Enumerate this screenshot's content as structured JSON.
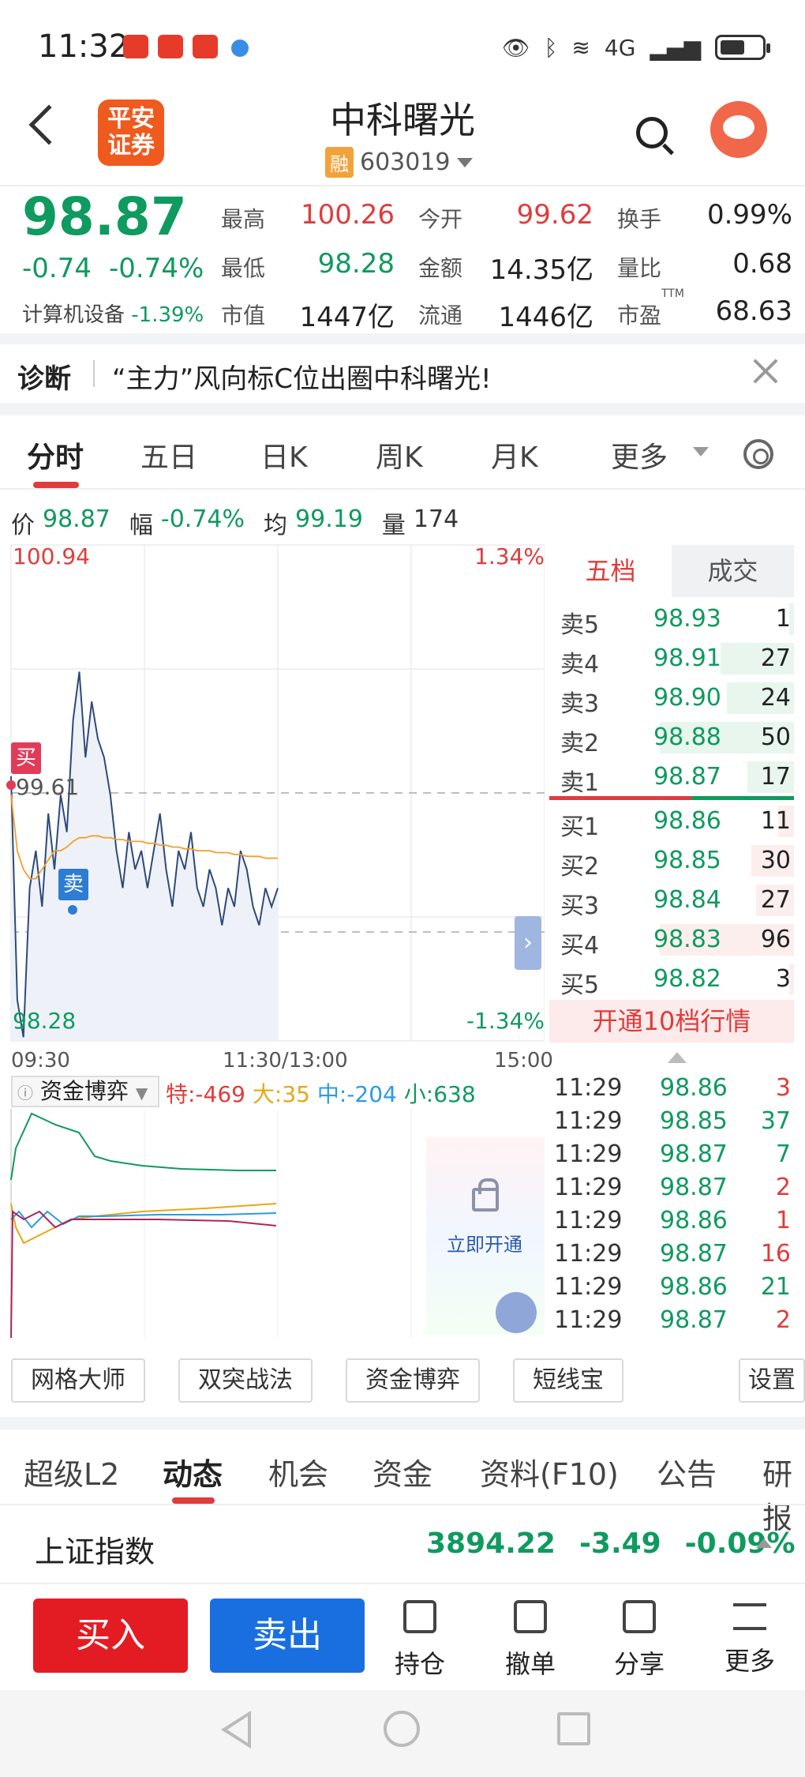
{
  "status_bar": {
    "time": "11:32",
    "network": "4G"
  },
  "header": {
    "logo_text_line1": "平安",
    "logo_text_line2": "证券",
    "title": "中科曙光",
    "margin_tag": "融",
    "code": "603019"
  },
  "quote": {
    "price": "98.87",
    "change": "-0.74",
    "change_pct": "-0.74%",
    "sector_name": "计算机设备",
    "sector_change": "-1.39%",
    "stats": [
      {
        "label": "最高",
        "value": "100.26",
        "color": "red"
      },
      {
        "label": "今开",
        "value": "99.62",
        "color": "red"
      },
      {
        "label": "换手",
        "value": "0.99%",
        "color": "dark"
      },
      {
        "label": "最低",
        "value": "98.28",
        "color": "green"
      },
      {
        "label": "金额",
        "value": "14.35亿",
        "color": "dark"
      },
      {
        "label": "量比",
        "value": "0.68",
        "color": "dark"
      },
      {
        "label": "市值",
        "value": "1447亿",
        "color": "dark"
      },
      {
        "label": "流通",
        "value": "1446亿",
        "color": "dark"
      },
      {
        "label": "市盈",
        "value": "68.63",
        "color": "dark"
      }
    ],
    "ttm_label": "TTM"
  },
  "diagnosis": {
    "tag": "诊断",
    "text": "“主力”风向标C位出圈中科曙光!"
  },
  "chart_tabs": [
    "分时",
    "五日",
    "日K",
    "周K",
    "月K",
    "更多"
  ],
  "info_row": {
    "price_label": "价",
    "price": "98.87",
    "range_label": "幅",
    "range": "-0.74%",
    "avg_label": "均",
    "avg": "99.19",
    "vol_label": "量",
    "vol": "174"
  },
  "chart_data": {
    "type": "line",
    "title": "",
    "y_max_label": "100.94",
    "y_min_label": "98.28",
    "y_top_pct": "1.34%",
    "y_bottom_pct": "-1.34%",
    "prev_close_label": "99.61",
    "ylim": [
      98.28,
      100.94
    ],
    "x_ticks": [
      "09:30",
      "11:30/13:00",
      "15:00"
    ],
    "series": [
      {
        "values": [
          99.7,
          98.5,
          98.3,
          99.1,
          99.3,
          99.0,
          99.5,
          99.2,
          99.6,
          99.4,
          100.0,
          100.26,
          99.8,
          100.1,
          99.9,
          99.8,
          99.6,
          99.3,
          99.1,
          99.4,
          99.2,
          99.3,
          99.1,
          99.3,
          99.5,
          99.2,
          99.0,
          99.3,
          99.2,
          99.4,
          99.1,
          99.0,
          99.2,
          99.1,
          98.9,
          99.1,
          99.0,
          99.3,
          99.2,
          99.0,
          98.9,
          99.1,
          99.0,
          99.1
        ]
      },
      {
        "values": [
          99.6,
          99.3,
          99.2,
          99.15,
          99.15,
          99.2,
          99.25,
          99.3,
          99.3,
          99.32,
          99.35,
          99.37,
          99.37,
          99.38,
          99.38,
          99.37,
          99.37,
          99.36,
          99.36,
          99.35,
          99.35,
          99.35,
          99.34,
          99.34,
          99.33,
          99.33,
          99.32,
          99.32,
          99.31,
          99.31,
          99.3,
          99.3,
          99.3,
          99.29,
          99.29,
          99.29,
          99.28,
          99.28,
          99.27,
          99.27,
          99.27,
          99.26,
          99.26,
          99.26
        ]
      }
    ],
    "markers": [
      {
        "label": "买"
      },
      {
        "label": "卖"
      }
    ]
  },
  "order_book": {
    "tabs": [
      "五档",
      "成交"
    ],
    "asks": [
      {
        "name": "卖5",
        "price": "98.93",
        "qty": "1",
        "bar": 0.02
      },
      {
        "name": "卖4",
        "price": "98.91",
        "qty": "27",
        "bar": 0.55
      },
      {
        "name": "卖3",
        "price": "98.90",
        "qty": "24",
        "bar": 0.5
      },
      {
        "name": "卖2",
        "price": "98.88",
        "qty": "50",
        "bar": 1.0
      },
      {
        "name": "卖1",
        "price": "98.87",
        "qty": "17",
        "bar": 0.35
      }
    ],
    "bids": [
      {
        "name": "买1",
        "price": "98.86",
        "qty": "11",
        "bar": 0.12
      },
      {
        "name": "买2",
        "price": "98.85",
        "qty": "30",
        "bar": 0.32
      },
      {
        "name": "买3",
        "price": "98.84",
        "qty": "27",
        "bar": 0.28
      },
      {
        "name": "买4",
        "price": "98.83",
        "qty": "96",
        "bar": 1.0
      },
      {
        "name": "买5",
        "price": "98.82",
        "qty": "3",
        "bar": 0.03
      }
    ],
    "open_deep": "开通10档行情"
  },
  "capital": {
    "box_label": "资金博弈",
    "te": "特:-469",
    "da": "大:35",
    "zhong": "中:-204",
    "xiao": "小:638",
    "open_now": "立即开通"
  },
  "ticks": [
    {
      "time": "11:29",
      "price": "98.86",
      "qty": "3",
      "pc": "green",
      "qc": "red"
    },
    {
      "time": "11:29",
      "price": "98.85",
      "qty": "37",
      "pc": "green",
      "qc": "green"
    },
    {
      "time": "11:29",
      "price": "98.87",
      "qty": "7",
      "pc": "green",
      "qc": "green"
    },
    {
      "time": "11:29",
      "price": "98.87",
      "qty": "2",
      "pc": "green",
      "qc": "red"
    },
    {
      "time": "11:29",
      "price": "98.86",
      "qty": "1",
      "pc": "green",
      "qc": "red"
    },
    {
      "time": "11:29",
      "price": "98.87",
      "qty": "16",
      "pc": "green",
      "qc": "red"
    },
    {
      "time": "11:29",
      "price": "98.86",
      "qty": "21",
      "pc": "green",
      "qc": "green"
    },
    {
      "time": "11:29",
      "price": "98.87",
      "qty": "2",
      "pc": "green",
      "qc": "red"
    }
  ],
  "tools": [
    "网格大师",
    "双突战法",
    "资金博弈",
    "短线宝",
    "设置"
  ],
  "bottom_tabs": [
    "超级L2",
    "动态",
    "机会",
    "资金",
    "资料(F10)",
    "公告",
    "研报"
  ],
  "index": {
    "name": "上证指数",
    "value": "3894.22",
    "change": "-3.49",
    "pct": "-0.09%"
  },
  "actions": {
    "buy": "买入",
    "sell": "卖出",
    "position": "持仓",
    "cancel": "撤单",
    "share": "分享",
    "more": "更多"
  },
  "colors": {
    "red": "#e03c3c",
    "green": "#0f9a5f",
    "buy_button": "#e31c23",
    "sell_button": "#1a6fe0"
  }
}
